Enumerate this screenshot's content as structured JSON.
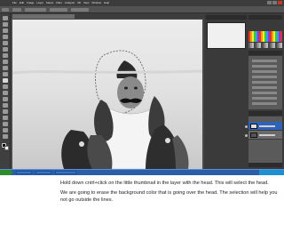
{
  "app": {
    "menu": [
      "File",
      "Edit",
      "Image",
      "Layer",
      "Select",
      "Filter",
      "Analysis",
      "3D",
      "View",
      "Window",
      "Help"
    ]
  },
  "toolbox": {
    "tool_icons": [
      "move-icon",
      "marquee-icon",
      "lasso-icon",
      "quick-select-icon",
      "crop-icon",
      "eyedropper-icon",
      "healing-icon",
      "brush-icon",
      "clone-stamp-icon",
      "history-brush-icon",
      "eraser-icon",
      "gradient-icon",
      "blur-icon",
      "dodge-icon",
      "pen-icon",
      "type-icon",
      "path-select-icon",
      "shape-icon",
      "hand-icon",
      "zoom-icon"
    ]
  },
  "colors": {
    "foreground": "#000000",
    "background": "#ffffff",
    "layer_selected": "#2e63b9",
    "taskbar": "#2a5fa8",
    "start": "#2e8b2e"
  },
  "layers": {
    "items": [
      {
        "name": "layer-1",
        "selected": true
      },
      {
        "name": "background",
        "selected": false
      }
    ]
  },
  "caption": {
    "line1": "Hold down cntrl+click on the little thumbnail in the layer with the head. This will select the head.",
    "line2": "We are going to erase the background color that is going over the head. The selection will help you not go outside the lines."
  }
}
